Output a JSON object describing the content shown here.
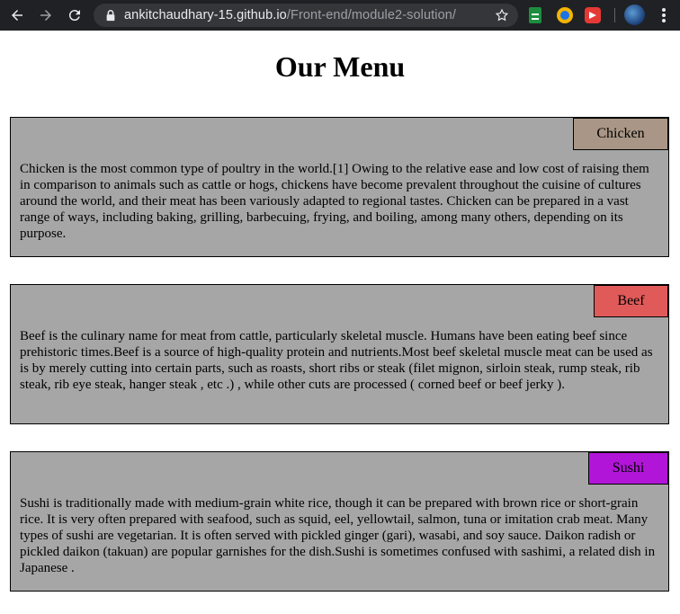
{
  "browser": {
    "url_host": "ankitchaudhary-15.github.io",
    "url_path": "/Front-end/module2-solution/"
  },
  "page": {
    "title": "Our Menu"
  },
  "sections": [
    {
      "label": "Chicken",
      "color": "#a99686",
      "text": "Chicken is the most common type of poultry in the world.[1] Owing to the relative ease and low cost of raising them in comparison to animals such as cattle or hogs, chickens have become prevalent throughout the cuisine of cultures around the world, and their meat has been variously adapted to regional tastes. Chicken can be prepared in a vast range of ways, including baking, grilling, barbecuing, frying, and boiling, among many others, depending on its purpose."
    },
    {
      "label": "Beef",
      "color": "#e05a59",
      "text": "Beef is the culinary name for meat from cattle, particularly skeletal muscle. Humans have been eating beef since prehistoric times.Beef is a source of high-quality protein and nutrients.Most beef skeletal muscle meat can be used as is by merely cutting into certain parts, such as roasts, short ribs or steak (filet mignon, sirloin steak, rump steak, rib steak, rib eye steak, hanger steak , etc .) , while other cuts are processed ( corned beef or beef jerky )."
    },
    {
      "label": "Sushi",
      "color": "#b115d8",
      "text": "Sushi is traditionally made with medium-grain white rice, though it can be prepared with brown rice or short-grain rice. It is very often prepared with seafood, such as squid, eel, yellowtail, salmon, tuna or imitation crab meat. Many types of sushi are vegetarian. It is often served with pickled ginger (gari), wasabi, and soy sauce. Daikon radish or pickled daikon (takuan) are popular garnishes for the dish.Sushi is sometimes confused with sashimi, a related dish in Japanese ."
    }
  ]
}
